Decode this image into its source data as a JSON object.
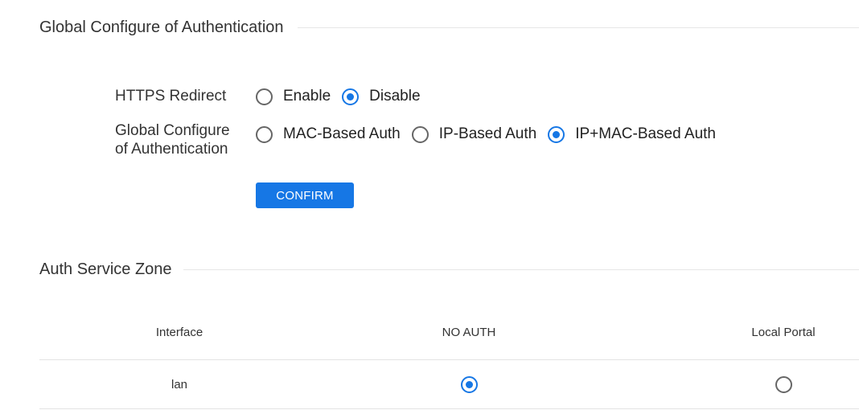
{
  "global_section": {
    "title": "Global Configure of Authentication",
    "https_redirect": {
      "label": "HTTPS Redirect",
      "options": [
        {
          "label": "Enable",
          "checked": false
        },
        {
          "label": "Disable",
          "checked": true
        }
      ]
    },
    "auth_mode": {
      "label_line1": "Global Configure",
      "label_line2": "of Authentication",
      "options": [
        {
          "label": "MAC-Based Auth",
          "checked": false
        },
        {
          "label": "IP-Based Auth",
          "checked": false
        },
        {
          "label": "IP+MAC-Based Auth",
          "checked": true
        }
      ]
    },
    "confirm_label": "CONFIRM"
  },
  "zone_section": {
    "title": "Auth Service Zone",
    "columns": [
      "Interface",
      "NO AUTH",
      "Local Portal"
    ],
    "rows": [
      {
        "interface": "lan",
        "no_auth": true,
        "local_portal": false
      }
    ]
  },
  "colors": {
    "accent": "#1677e5",
    "text": "#333333",
    "divider": "#e6e6e6"
  }
}
